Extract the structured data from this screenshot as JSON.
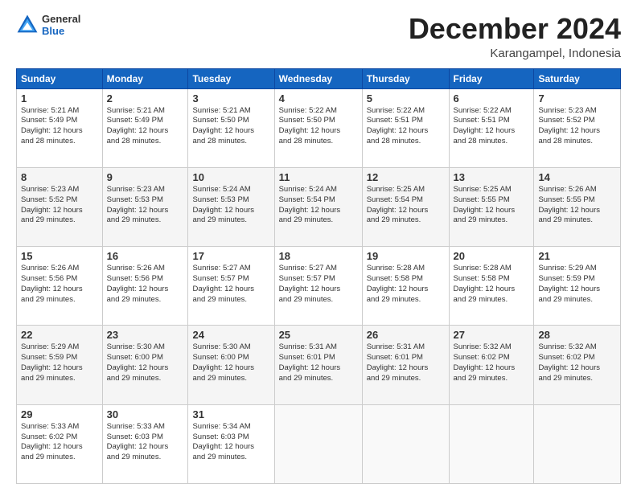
{
  "header": {
    "logo_line1": "General",
    "logo_line2": "Blue",
    "month": "December 2024",
    "location": "Karangampel, Indonesia"
  },
  "days_of_week": [
    "Sunday",
    "Monday",
    "Tuesday",
    "Wednesday",
    "Thursday",
    "Friday",
    "Saturday"
  ],
  "weeks": [
    [
      {
        "day": 1,
        "info": "Sunrise: 5:21 AM\nSunset: 5:49 PM\nDaylight: 12 hours\nand 28 minutes."
      },
      {
        "day": 2,
        "info": "Sunrise: 5:21 AM\nSunset: 5:49 PM\nDaylight: 12 hours\nand 28 minutes."
      },
      {
        "day": 3,
        "info": "Sunrise: 5:21 AM\nSunset: 5:50 PM\nDaylight: 12 hours\nand 28 minutes."
      },
      {
        "day": 4,
        "info": "Sunrise: 5:22 AM\nSunset: 5:50 PM\nDaylight: 12 hours\nand 28 minutes."
      },
      {
        "day": 5,
        "info": "Sunrise: 5:22 AM\nSunset: 5:51 PM\nDaylight: 12 hours\nand 28 minutes."
      },
      {
        "day": 6,
        "info": "Sunrise: 5:22 AM\nSunset: 5:51 PM\nDaylight: 12 hours\nand 28 minutes."
      },
      {
        "day": 7,
        "info": "Sunrise: 5:23 AM\nSunset: 5:52 PM\nDaylight: 12 hours\nand 28 minutes."
      }
    ],
    [
      {
        "day": 8,
        "info": "Sunrise: 5:23 AM\nSunset: 5:52 PM\nDaylight: 12 hours\nand 29 minutes."
      },
      {
        "day": 9,
        "info": "Sunrise: 5:23 AM\nSunset: 5:53 PM\nDaylight: 12 hours\nand 29 minutes."
      },
      {
        "day": 10,
        "info": "Sunrise: 5:24 AM\nSunset: 5:53 PM\nDaylight: 12 hours\nand 29 minutes."
      },
      {
        "day": 11,
        "info": "Sunrise: 5:24 AM\nSunset: 5:54 PM\nDaylight: 12 hours\nand 29 minutes."
      },
      {
        "day": 12,
        "info": "Sunrise: 5:25 AM\nSunset: 5:54 PM\nDaylight: 12 hours\nand 29 minutes."
      },
      {
        "day": 13,
        "info": "Sunrise: 5:25 AM\nSunset: 5:55 PM\nDaylight: 12 hours\nand 29 minutes."
      },
      {
        "day": 14,
        "info": "Sunrise: 5:26 AM\nSunset: 5:55 PM\nDaylight: 12 hours\nand 29 minutes."
      }
    ],
    [
      {
        "day": 15,
        "info": "Sunrise: 5:26 AM\nSunset: 5:56 PM\nDaylight: 12 hours\nand 29 minutes."
      },
      {
        "day": 16,
        "info": "Sunrise: 5:26 AM\nSunset: 5:56 PM\nDaylight: 12 hours\nand 29 minutes."
      },
      {
        "day": 17,
        "info": "Sunrise: 5:27 AM\nSunset: 5:57 PM\nDaylight: 12 hours\nand 29 minutes."
      },
      {
        "day": 18,
        "info": "Sunrise: 5:27 AM\nSunset: 5:57 PM\nDaylight: 12 hours\nand 29 minutes."
      },
      {
        "day": 19,
        "info": "Sunrise: 5:28 AM\nSunset: 5:58 PM\nDaylight: 12 hours\nand 29 minutes."
      },
      {
        "day": 20,
        "info": "Sunrise: 5:28 AM\nSunset: 5:58 PM\nDaylight: 12 hours\nand 29 minutes."
      },
      {
        "day": 21,
        "info": "Sunrise: 5:29 AM\nSunset: 5:59 PM\nDaylight: 12 hours\nand 29 minutes."
      }
    ],
    [
      {
        "day": 22,
        "info": "Sunrise: 5:29 AM\nSunset: 5:59 PM\nDaylight: 12 hours\nand 29 minutes."
      },
      {
        "day": 23,
        "info": "Sunrise: 5:30 AM\nSunset: 6:00 PM\nDaylight: 12 hours\nand 29 minutes."
      },
      {
        "day": 24,
        "info": "Sunrise: 5:30 AM\nSunset: 6:00 PM\nDaylight: 12 hours\nand 29 minutes."
      },
      {
        "day": 25,
        "info": "Sunrise: 5:31 AM\nSunset: 6:01 PM\nDaylight: 12 hours\nand 29 minutes."
      },
      {
        "day": 26,
        "info": "Sunrise: 5:31 AM\nSunset: 6:01 PM\nDaylight: 12 hours\nand 29 minutes."
      },
      {
        "day": 27,
        "info": "Sunrise: 5:32 AM\nSunset: 6:02 PM\nDaylight: 12 hours\nand 29 minutes."
      },
      {
        "day": 28,
        "info": "Sunrise: 5:32 AM\nSunset: 6:02 PM\nDaylight: 12 hours\nand 29 minutes."
      }
    ],
    [
      {
        "day": 29,
        "info": "Sunrise: 5:33 AM\nSunset: 6:02 PM\nDaylight: 12 hours\nand 29 minutes."
      },
      {
        "day": 30,
        "info": "Sunrise: 5:33 AM\nSunset: 6:03 PM\nDaylight: 12 hours\nand 29 minutes."
      },
      {
        "day": 31,
        "info": "Sunrise: 5:34 AM\nSunset: 6:03 PM\nDaylight: 12 hours\nand 29 minutes."
      },
      null,
      null,
      null,
      null
    ]
  ]
}
